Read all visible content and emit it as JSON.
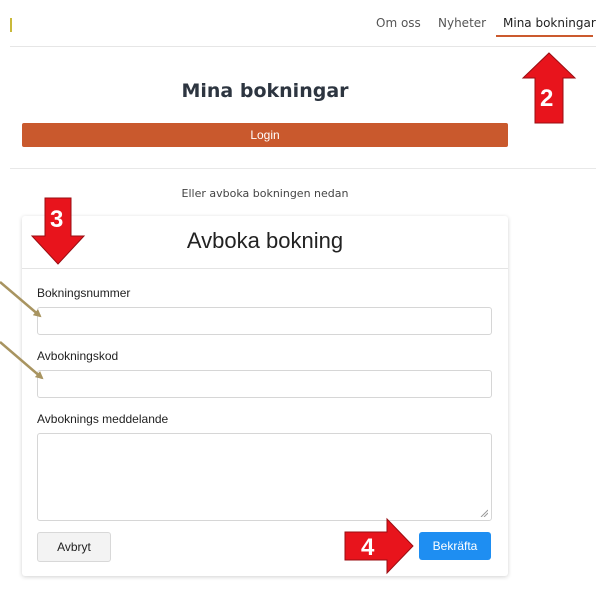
{
  "nav": {
    "items": [
      {
        "label": "Om oss"
      },
      {
        "label": "Nyheter"
      },
      {
        "label": "Mina bokningar"
      }
    ],
    "active_color": "#cb5a2e"
  },
  "page": {
    "title": "Mina bokningar",
    "login_label": "Login",
    "alt_text": "Eller avboka bokningen nedan"
  },
  "form": {
    "title": "Avboka bokning",
    "booking_number_label": "Bokningsnummer",
    "booking_number_value": "",
    "cancel_code_label": "Avbokningskod",
    "cancel_code_value": "",
    "message_label": "Avboknings meddelande",
    "message_value": "",
    "cancel_button": "Avbryt",
    "confirm_button": "Bekräfta"
  },
  "annotations": {
    "markers": [
      "2",
      "3",
      "4"
    ],
    "marker_color": "#e8141c",
    "pointer_color": "#a89460"
  }
}
